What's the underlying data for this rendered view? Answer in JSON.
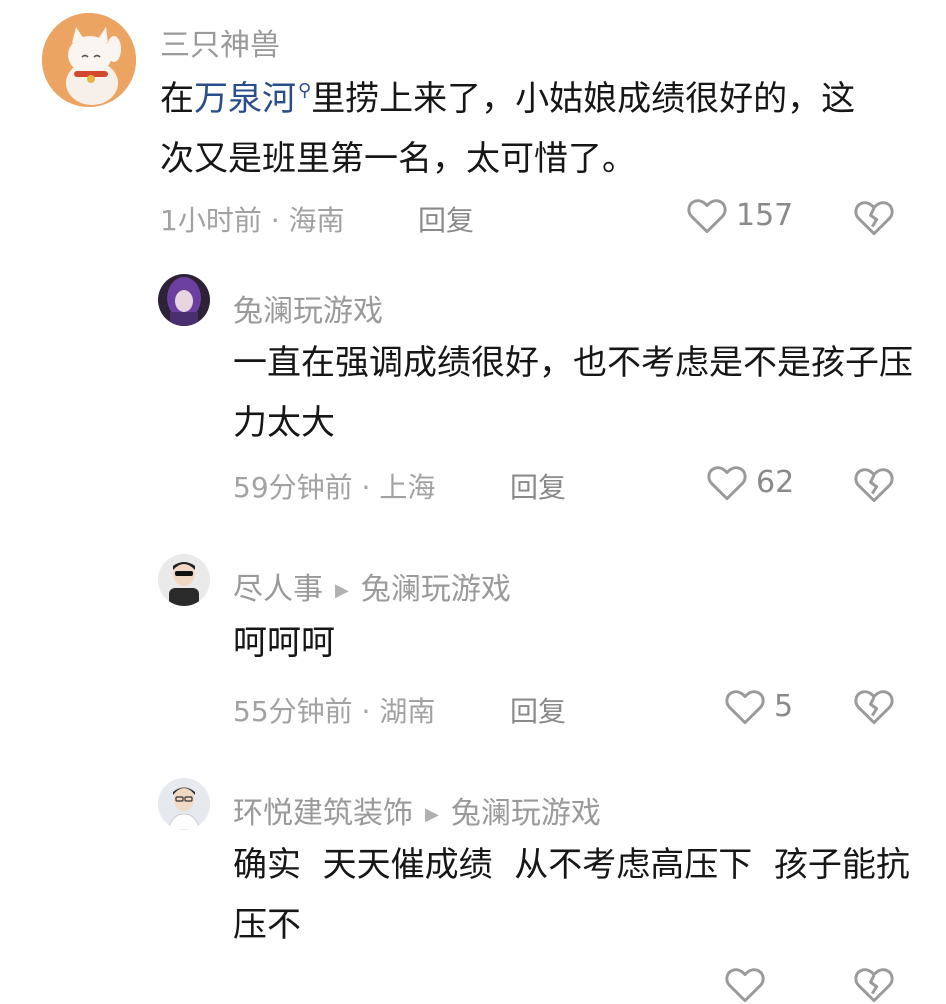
{
  "comments": [
    {
      "user": "三只神兽",
      "text_before": "在",
      "link": "万泉河",
      "text_after": "里捞上来了，小姑娘成绩很好的，这次又是班里第一名，太可惜了。",
      "time_location": "1小时前 · 海南",
      "reply_label": "回复",
      "likes": "157"
    },
    {
      "user": "兔澜玩游戏",
      "text": "一直在强调成绩很好，也不考虑是不是孩子压力太大",
      "time_location": "59分钟前 · 上海",
      "reply_label": "回复",
      "likes": "62"
    },
    {
      "user": "尽人事",
      "reply_to": "兔澜玩游戏",
      "text": "呵呵呵",
      "time_location": "55分钟前 · 湖南",
      "reply_label": "回复",
      "likes": "5"
    },
    {
      "user": "环悦建筑装饰",
      "reply_to": "兔澜玩游戏",
      "text": "确实  天天催成绩  从不考虑高压下  孩子能抗压不"
    }
  ],
  "icons": {
    "like": "heart-outline-icon",
    "dislike": "broken-heart-icon",
    "search_link": "search-icon",
    "reply_arrow": "triangle-right-icon"
  },
  "colors": {
    "link": "#2a4e8a",
    "username": "#9a9a9a",
    "content": "#161616",
    "meta": "#a2a2a2"
  }
}
